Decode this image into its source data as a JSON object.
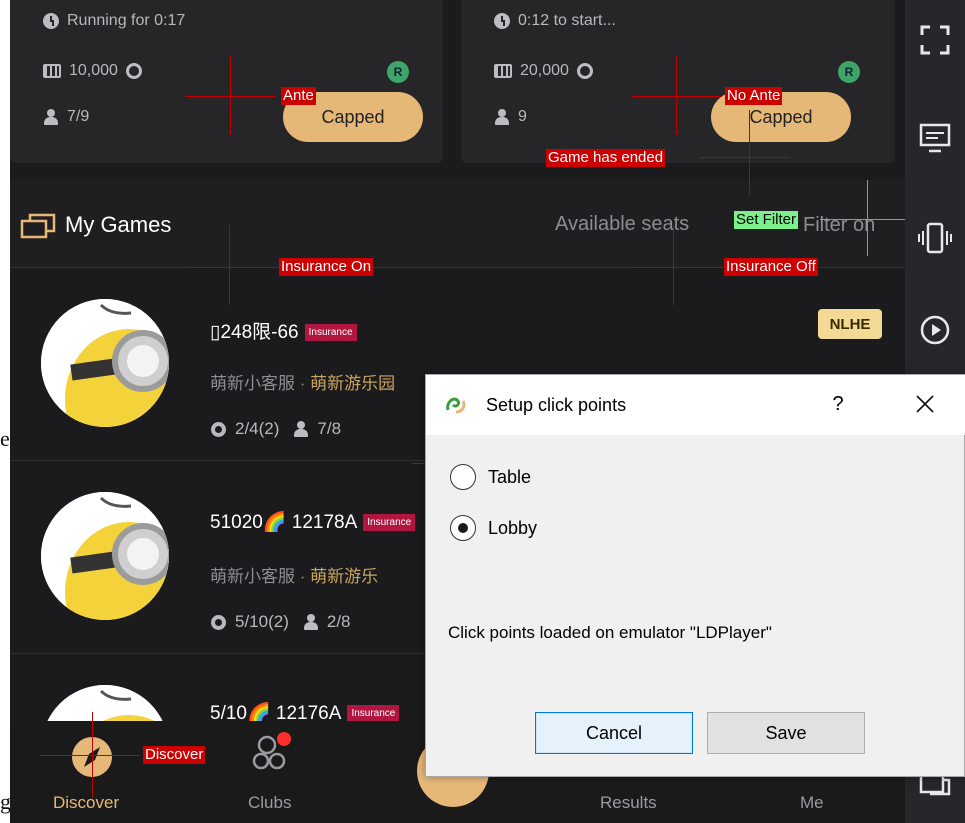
{
  "edge_text": {
    "top_glyph": "e",
    "bottom_glyph": "g"
  },
  "cards": [
    {
      "status": "Running for 0:17",
      "stake": "10,000",
      "players": "7/9",
      "badge": "R",
      "button": "Capped"
    },
    {
      "status": "0:12 to start...",
      "stake": "20,000",
      "players": "9",
      "badge": "R",
      "button": "Capped"
    }
  ],
  "my_games": {
    "title": "My Games",
    "available_seats": "Available seats",
    "filter": "Filter on"
  },
  "games": [
    {
      "title": "▯248限-66",
      "insurance": "Insurance",
      "host": "萌新小客服",
      "separator": "·",
      "club": "萌新游乐园",
      "tables": "2/4(2)",
      "players": "7/8",
      "game_type": "NLHE"
    },
    {
      "title": "51020🌈 12178A",
      "insurance": "Insurance",
      "host": "萌新小客服",
      "separator": "·",
      "club": "萌新游乐",
      "tables": "5/10(2)",
      "players": "2/8"
    },
    {
      "title": "5/10🌈 12176A",
      "insurance": "Insurance"
    }
  ],
  "bottom_nav": [
    {
      "label": "Discover",
      "icon": "compass-icon",
      "active": true
    },
    {
      "label": "Clubs",
      "icon": "clubs-icon"
    },
    {
      "label": "Results",
      "icon": "results-icon"
    },
    {
      "label": "Me",
      "icon": "me-icon"
    }
  ],
  "overlay_labels": {
    "ante": "Ante",
    "no_ante": "No Ante",
    "game_has_ended": "Game has ended",
    "set_filter": "Set Filter",
    "insurance_on": "Insurance On",
    "insurance_off": "Insurance Off",
    "discover": "Discover"
  },
  "sidebar_icons": [
    "fullscreen-icon",
    "monitor-icon",
    "shake-icon",
    "replay-icon",
    "display-icon"
  ],
  "dialog": {
    "title": "Setup click points",
    "help": "?",
    "options": [
      {
        "label": "Table",
        "checked": false
      },
      {
        "label": "Lobby",
        "checked": true
      }
    ],
    "message": "Click points loaded on emulator \"LDPlayer\"",
    "cancel": "Cancel",
    "save": "Save"
  },
  "colors": {
    "app_bg": "#1b1b1d",
    "accent_gold": "#e6b878",
    "insurance_red": "#b0163f",
    "overlay_red": "#cc0000",
    "overlay_green": "#7cf08a"
  }
}
